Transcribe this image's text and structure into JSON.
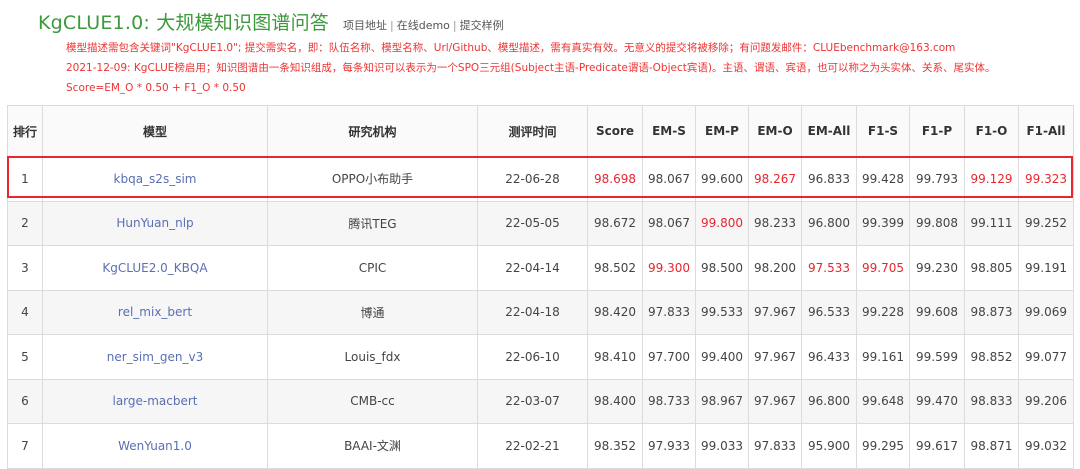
{
  "header": {
    "title": "KgCLUE1.0: 大规模知识图谱问答",
    "links": [
      "项目地址",
      "在线demo",
      "提交样例"
    ],
    "notices": [
      "模型描述需包含关键词\"KgCLUE1.0\"; 提交需实名，即：队伍名称、模型名称、Url/Github、模型描述，需有真实有效。无意义的提交将被移除；有问题发邮件：CLUEbenchmark@163.com",
      "2021-12-09: KgCLUE榜启用；知识图谱由一条知识组成，每条知识可以表示为一个SPO三元组(Subject主语-Predicate谓语-Object宾语)。主语、谓语、宾语，也可以称之为头实体、关系、尾实体。",
      "Score=EM_O * 0.50 + F1_O * 0.50"
    ]
  },
  "colors": {
    "title": "#3c9a3c",
    "highlight": "#e8262d",
    "model_link": "#5a6fb4"
  },
  "table": {
    "columns": [
      "排行",
      "模型",
      "研究机构",
      "测评时间",
      "Score",
      "EM-S",
      "EM-P",
      "EM-O",
      "EM-All",
      "F1-S",
      "F1-P",
      "F1-O",
      "F1-All"
    ],
    "rows": [
      {
        "cells": [
          "1",
          "kbqa_s2s_sim",
          "OPPO小布助手",
          "22-06-28",
          "98.698",
          "98.067",
          "99.600",
          "98.267",
          "96.833",
          "99.428",
          "99.793",
          "99.129",
          "99.323"
        ],
        "highlight": [
          4,
          7,
          11,
          12
        ]
      },
      {
        "cells": [
          "2",
          "HunYuan_nlp",
          "腾讯TEG",
          "22-05-05",
          "98.672",
          "98.067",
          "99.800",
          "98.233",
          "96.800",
          "99.399",
          "99.808",
          "99.111",
          "99.252"
        ],
        "highlight": [
          6
        ]
      },
      {
        "cells": [
          "3",
          "KgCLUE2.0_KBQA",
          "CPIC",
          "22-04-14",
          "98.502",
          "99.300",
          "98.500",
          "98.200",
          "97.533",
          "99.705",
          "99.230",
          "98.805",
          "99.191"
        ],
        "highlight": [
          5,
          8,
          9
        ]
      },
      {
        "cells": [
          "4",
          "rel_mix_bert",
          "博通",
          "22-04-18",
          "98.420",
          "97.833",
          "99.533",
          "97.967",
          "96.533",
          "99.228",
          "99.608",
          "98.873",
          "99.069"
        ],
        "highlight": []
      },
      {
        "cells": [
          "5",
          "ner_sim_gen_v3",
          "Louis_fdx",
          "22-06-10",
          "98.410",
          "97.700",
          "99.400",
          "97.967",
          "96.433",
          "99.161",
          "99.599",
          "98.852",
          "99.077"
        ],
        "highlight": []
      },
      {
        "cells": [
          "6",
          "large-macbert",
          "CMB-cc",
          "22-03-07",
          "98.400",
          "98.733",
          "98.967",
          "97.967",
          "96.800",
          "99.648",
          "99.470",
          "98.833",
          "99.206"
        ],
        "highlight": []
      },
      {
        "cells": [
          "7",
          "WenYuan1.0",
          "BAAI-文渊",
          "22-02-21",
          "98.352",
          "97.933",
          "99.033",
          "97.833",
          "95.900",
          "99.295",
          "99.617",
          "98.871",
          "99.032"
        ],
        "highlight": []
      }
    ]
  }
}
